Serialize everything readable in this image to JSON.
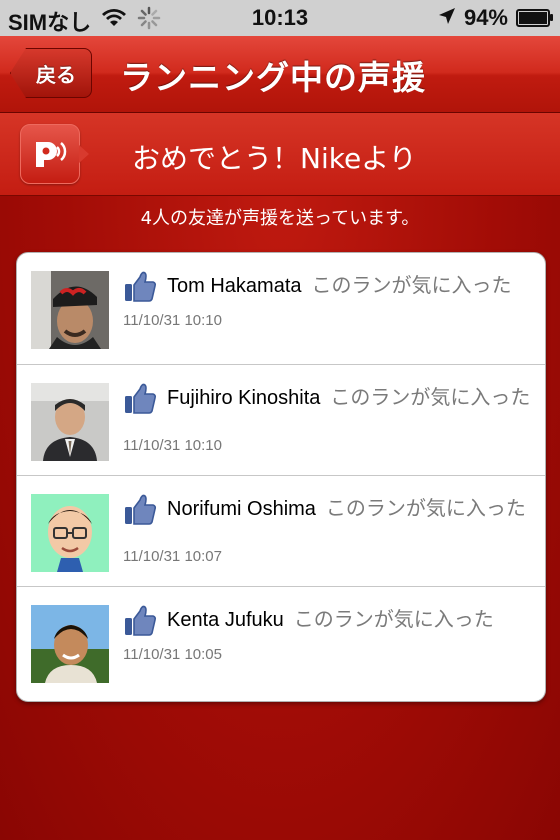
{
  "status_bar": {
    "carrier": "SIMなし",
    "time": "10:13",
    "battery": "94%",
    "battery_level": 0.94
  },
  "nav": {
    "back_label": "戻る",
    "title": "ランニング中の声援"
  },
  "banner": {
    "text": "おめでとう！Nikeより",
    "icon": "speaker-voice-icon"
  },
  "subtitle": "4人の友達が声援を送っています。",
  "colors": {
    "accent_red": "#c41d12",
    "like_blue": "#3b5998"
  },
  "cheers": [
    {
      "name": "Tom Hakamata",
      "message": "このランが気に入った",
      "timestamp": "11/10/31  10:10",
      "icon": "like-thumb-icon"
    },
    {
      "name": "Fujihiro Kinoshita",
      "message": "このランが気に入った",
      "timestamp": "11/10/31  10:10",
      "icon": "like-thumb-icon"
    },
    {
      "name": "Norifumi Oshima",
      "message": "このランが気に入った",
      "timestamp": "11/10/31  10:07",
      "icon": "like-thumb-icon"
    },
    {
      "name": "Kenta Jufuku",
      "message": "このランが気に入った",
      "timestamp": "11/10/31  10:05",
      "icon": "like-thumb-icon"
    }
  ]
}
